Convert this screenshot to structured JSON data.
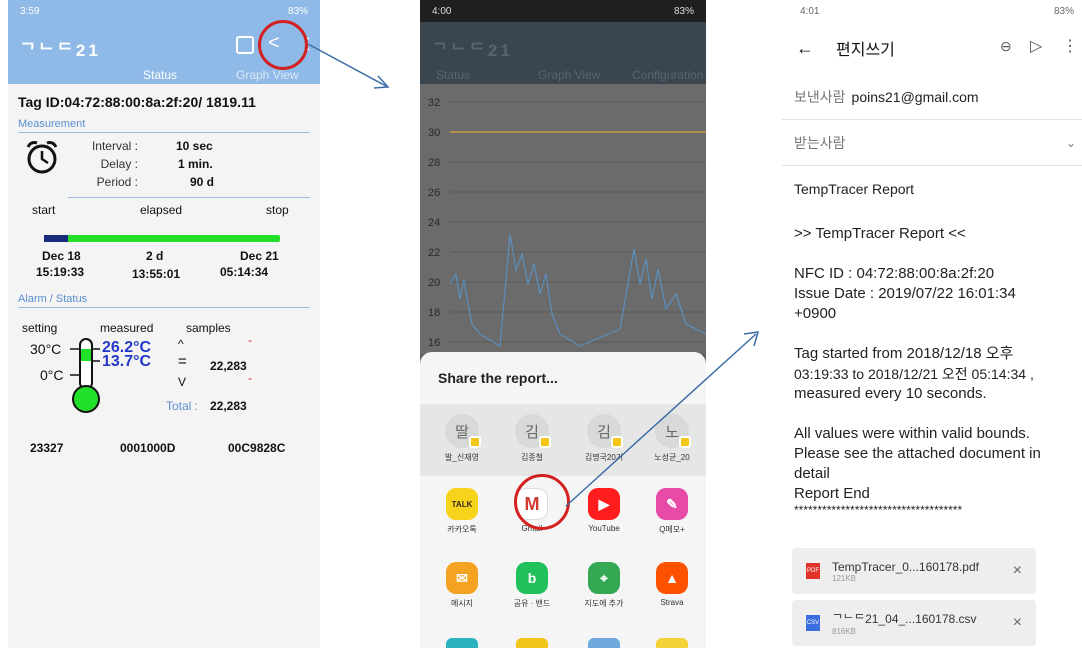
{
  "panel1": {
    "status_time": "3:59",
    "status_battery": "83%",
    "app_title": "ᄀᄂᄃ21",
    "tabs": [
      "Status",
      "Graph View"
    ],
    "tag_id": "Tag ID:04:72:88:00:8a:2f:20/ 1819.11",
    "measurement_header": "Measurement",
    "interval_label": "Interval :",
    "interval_value": "10 sec",
    "delay_label": "Delay :",
    "delay_value": "1 min.",
    "period_label": "Period :",
    "period_value": "90 d",
    "start_label": "start",
    "elapsed_label": "elapsed",
    "stop_label": "stop",
    "start_date": "Dec 18",
    "start_time": "15:19:33",
    "elapsed_days": "2 d",
    "elapsed_time": "13:55:01",
    "stop_date": "Dec 21",
    "stop_time": "05:14:34",
    "alarm_header": "Alarm / Status",
    "setting_label": "setting",
    "measured_label": "measured",
    "samples_label": "samples",
    "high_setting": "30°C",
    "low_setting": "0°C",
    "high_measured": "26.2°C",
    "low_measured": "13.7°C",
    "above_symbol": "^",
    "equal_symbol": "=",
    "below_symbol": "V",
    "dash1": "-",
    "dash2": "-",
    "samples_value": "22,283",
    "total_label": "Total :",
    "total_value": "22,283",
    "footer_values": [
      "23327",
      "0001000D",
      "00C9828C"
    ]
  },
  "panel2": {
    "status_time": "4:00",
    "status_battery": "83%",
    "app_title": "ᄀᄂᄃ21",
    "tabs": [
      "Status",
      "Graph View",
      "Configuration"
    ],
    "y_ticks": [
      "32",
      "30",
      "28",
      "26",
      "24",
      "22",
      "20",
      "18",
      "16"
    ],
    "sheet_title": "Share the report...",
    "contacts": [
      "발_신재영",
      "김종철",
      "김명국20기",
      "노성균_20"
    ],
    "contact_initials": [
      "딸",
      "김",
      "김",
      "노"
    ],
    "apps_row1": [
      "카카오톡",
      "Gmail",
      "YouTube",
      "Q메모+"
    ],
    "apps_row2": [
      "메시지",
      "공유 · 밴드",
      "지도에 추가",
      "Strava"
    ]
  },
  "panel3": {
    "status_time": "4:01",
    "status_battery": "83%",
    "compose_title": "편지쓰기",
    "from_label": "보낸사람",
    "from_value": "poins21@gmail.com",
    "to_label": "받는사람",
    "subject": "TempTracer Report",
    "body_heading": ">> TempTracer Report <<",
    "nfc_id": "NFC ID : 04:72:88:00:8a:2f:20",
    "issue_date": "Issue Date : 2019/07/22 16:01:34",
    "issue_tz": "+0900",
    "started_line1": "Tag started from 2018/12/18 오후",
    "started_line2": "03:19:33  to 2018/12/21 오전 05:14:34 ,",
    "started_line3": "measured every   10 seconds.",
    "bounds_line1": "All values were within valid bounds.",
    "bounds_line2": "Please see the attached document in",
    "bounds_line3": "detail",
    "report_end": "Report End",
    "stars": "************************************",
    "attachments": [
      {
        "name": "TempTracer_0...160178.pdf",
        "size": "121KB",
        "type": "PDF"
      },
      {
        "name": "ᄀᄂᄃ21_04_...160178.csv",
        "size": "816KB",
        "type": "CSV"
      }
    ]
  },
  "colors": {
    "app_blue": "#8fb9e6",
    "progress_green": "#22e02a",
    "progress_navy": "#1a2a7a",
    "measured_blue": "#2438c8",
    "alarm_red": "#d32020"
  }
}
